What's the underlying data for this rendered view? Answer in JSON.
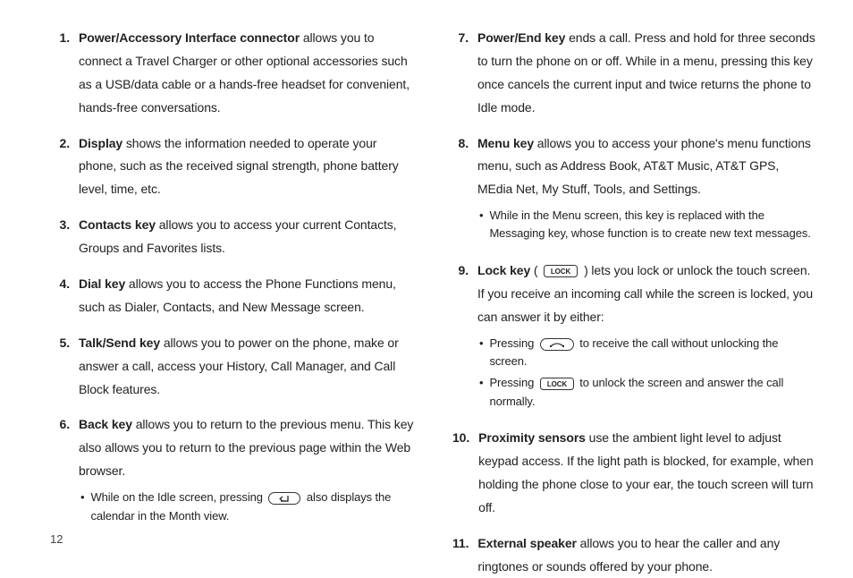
{
  "page_number": "12",
  "left": [
    {
      "n": "1.",
      "term": "Power/Accessory Interface connector",
      "rest": " allows you to connect a Travel Charger or other optional accessories such as a USB/data cable or a hands-free headset for convenient, hands-free conversations."
    },
    {
      "n": "2.",
      "term": "Display",
      "rest": " shows the information needed to operate your phone, such as the received signal strength, phone battery level, time, etc."
    },
    {
      "n": "3.",
      "term": "Contacts key",
      "rest": " allows you to access your current Contacts, Groups and Favorites lists."
    },
    {
      "n": "4.",
      "term": "Dial key",
      "rest": " allows you to access the Phone Functions menu, such as Dialer, Contacts, and New Message screen."
    },
    {
      "n": "5.",
      "term": "Talk/Send key",
      "rest": " allows you to power on the phone, make or answer a call, access your History, Call Manager, and Call Block features."
    },
    {
      "n": "6.",
      "term": "Back key",
      "rest": " allows you to return to the previous menu. This key also allows you to return to the previous page within the Web browser."
    }
  ],
  "left6_sub": {
    "pre": "While on the Idle screen, pressing ",
    "post": " also displays the calendar in the Month view."
  },
  "right": [
    {
      "n": "7.",
      "term": "Power/End key",
      "rest": " ends a call. Press and hold for three seconds to turn the phone on or off. While in a menu, pressing this key once cancels the current input and twice returns the phone to Idle mode."
    },
    {
      "n": "8.",
      "term": "Menu key",
      "rest": " allows you to access your phone's menu functions menu, such as Address Book, AT&T Music, AT&T GPS, MEdia Net, My Stuff, Tools, and Settings."
    }
  ],
  "right8_sub": "While in the Menu screen, this key is replaced with the Messaging key, whose function is to create new text messages.",
  "right9": {
    "n": "9.",
    "term": "Lock key",
    "pre": " ( ",
    "post": " ) lets you lock or unlock the touch screen. If you receive an incoming call while the screen is locked, you can answer it by either:"
  },
  "right9_sub1": {
    "pre": "Pressing ",
    "post": " to receive the call without unlocking the screen."
  },
  "right9_sub2": {
    "pre": "Pressing ",
    "post": " to unlock the screen and answer the call normally."
  },
  "right_tail": [
    {
      "n": "10.",
      "term": "Proximity sensors",
      "rest": " use the ambient light level to adjust keypad access.  If the light path is blocked, for example, when holding the phone close to your ear, the touch screen will turn off."
    },
    {
      "n": "11.",
      "term": "External speaker",
      "rest": " allows you to hear the caller and any ringtones or sounds offered by your phone."
    }
  ],
  "icons": {
    "back": "back-key-icon",
    "lock": "lock-key-icon",
    "talk": "talk-key-icon"
  }
}
